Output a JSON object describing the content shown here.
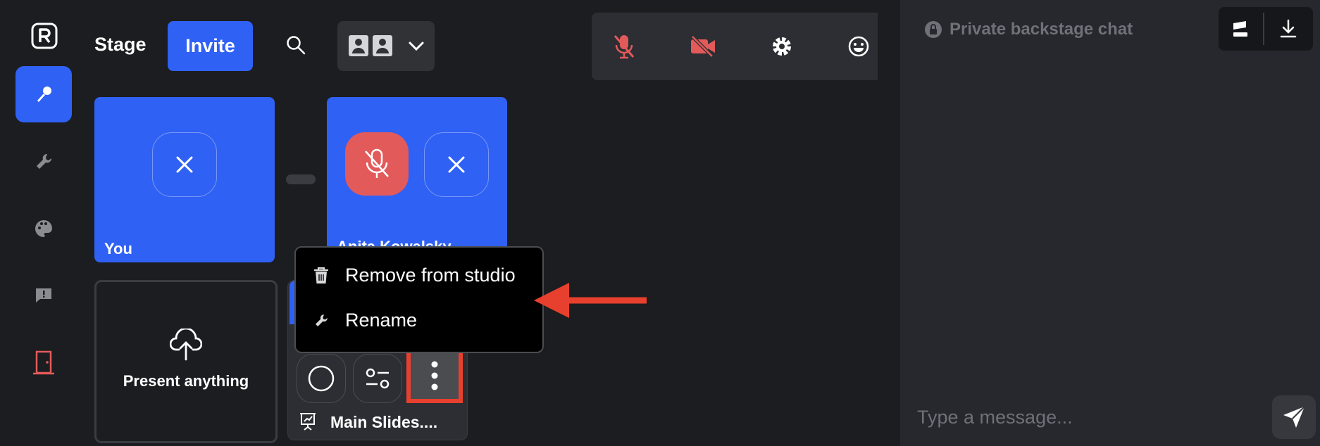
{
  "header": {
    "stage_label": "Stage",
    "invite_label": "Invite"
  },
  "tiles": {
    "you_label": "You",
    "guest_label": "Anita Kowalsky"
  },
  "present": {
    "label": "Present anything"
  },
  "slides": {
    "label": "Main Slides...."
  },
  "context_menu": {
    "items": [
      {
        "label": "Remove from studio",
        "icon": "trash-icon"
      },
      {
        "label": "Rename",
        "icon": "wrench-icon"
      }
    ]
  },
  "chat": {
    "title": "Private backstage chat",
    "placeholder": "Type a message..."
  },
  "colors": {
    "accent": "#3061f5",
    "danger": "#e25a5a",
    "annotation": "#e8402e"
  }
}
